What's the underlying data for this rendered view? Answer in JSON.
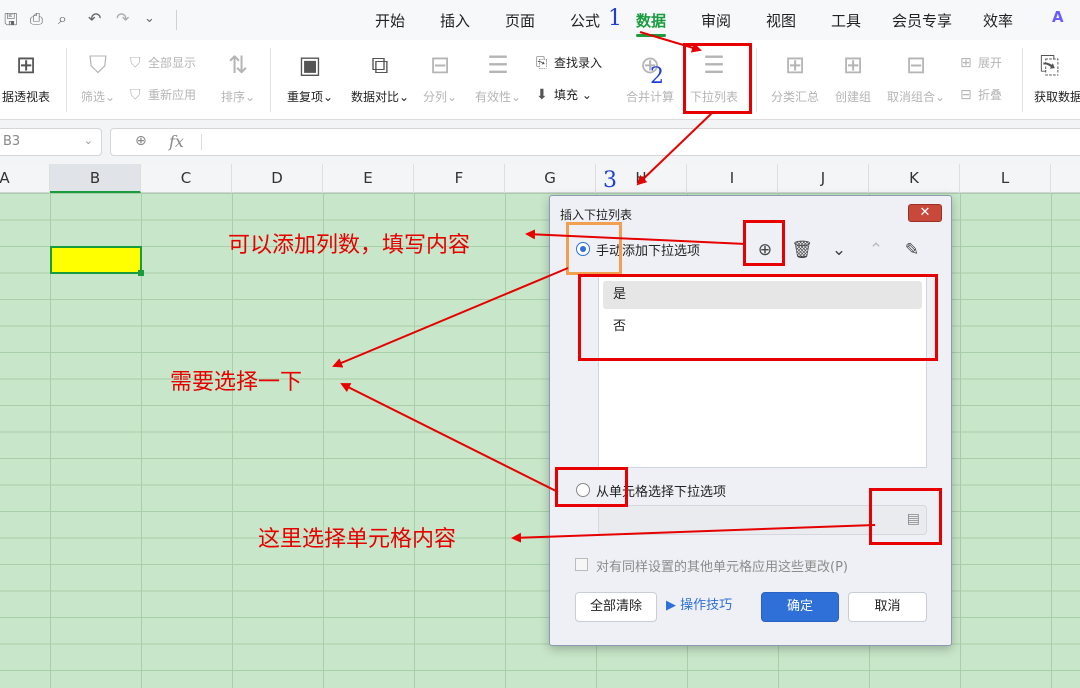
{
  "quick_access": {
    "icons": [
      "save-icon",
      "print-icon",
      "print-preview-icon",
      "undo-icon",
      "redo-icon",
      "more-chevron-icon"
    ]
  },
  "menu": {
    "items": [
      "开始",
      "插入",
      "页面",
      "公式",
      "数据",
      "审阅",
      "视图",
      "工具",
      "会员专享",
      "效率"
    ],
    "active": "数据",
    "accent_color": "#1a9c3e"
  },
  "ribbon": {
    "pivot": "据透视表",
    "filter": "筛选",
    "show_all": "全部显示",
    "reapply": "重新应用",
    "sort": "排序",
    "duplicates": "重复项",
    "compare": "数据对比",
    "split": "分列",
    "validity": "有效性",
    "find_entry": "查找录入",
    "fill": "填充",
    "merge_calc": "合并计算",
    "dropdown_list": "下拉列表",
    "subtotal": "分类汇总",
    "create_group": "创建组",
    "ungroup": "取消组合",
    "expand": "展开",
    "collapse": "折叠",
    "get_data": "获取数据"
  },
  "formula_bar": {
    "name_box": "B3",
    "fx_label": "fx"
  },
  "columns": [
    "A",
    "B",
    "C",
    "D",
    "E",
    "F",
    "G",
    "H",
    "I",
    "J",
    "K",
    "L"
  ],
  "selected_column": "B",
  "dialog": {
    "title": "插入下拉列表",
    "close_label": "✕",
    "manual_option": "手动添加下拉选项",
    "options": [
      "是",
      "否"
    ],
    "cell_option": "从单元格选择下拉选项",
    "apply_all": "对有同样设置的其他单元格应用这些更改(P)",
    "clear_all": "全部清除",
    "tips": "操作技巧",
    "ok": "确定",
    "cancel": "取消",
    "primary_color": "#2e6fd8"
  },
  "annotations": {
    "step1": "1",
    "step2": "2",
    "step3": "3",
    "add_columns": "可以添加列数，填写内容",
    "need_select": "需要选择一下",
    "select_cells": "这里选择单元格内容",
    "color": "#e60000"
  }
}
